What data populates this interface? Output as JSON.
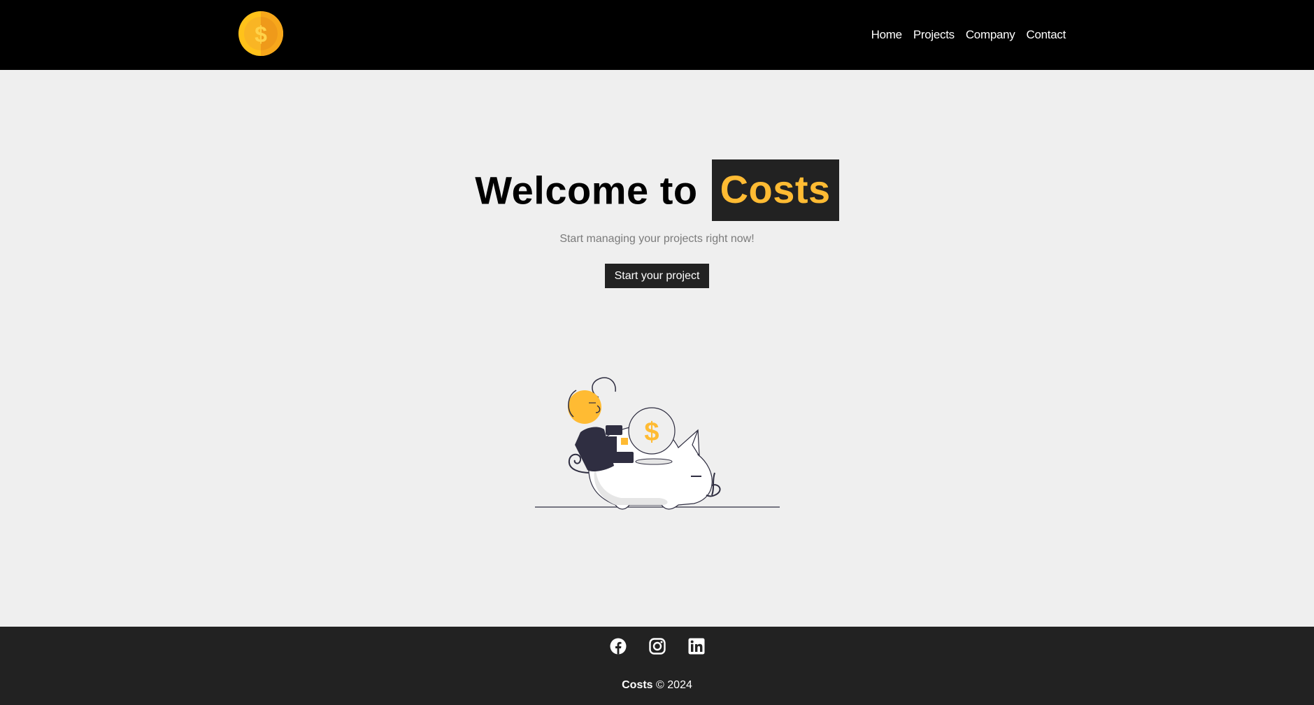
{
  "navbar": {
    "logo_icon": "dollar-coin-icon",
    "links": [
      {
        "label": "Home"
      },
      {
        "label": "Projects"
      },
      {
        "label": "Company"
      },
      {
        "label": "Contact"
      }
    ]
  },
  "hero": {
    "title_prefix": "Welcome to",
    "title_brand": "Costs",
    "subtitle": "Start managing your projects right now!",
    "cta_label": "Start your project",
    "illustration": "piggy-bank-savings-illustration"
  },
  "footer": {
    "social": [
      {
        "icon": "facebook-icon"
      },
      {
        "icon": "instagram-icon"
      },
      {
        "icon": "linkedin-icon"
      }
    ],
    "brand": "Costs",
    "copyright": "© 2024"
  },
  "colors": {
    "navbar_bg": "#000000",
    "page_bg": "#efefef",
    "accent": "#ffbb33",
    "dark": "#222222"
  }
}
